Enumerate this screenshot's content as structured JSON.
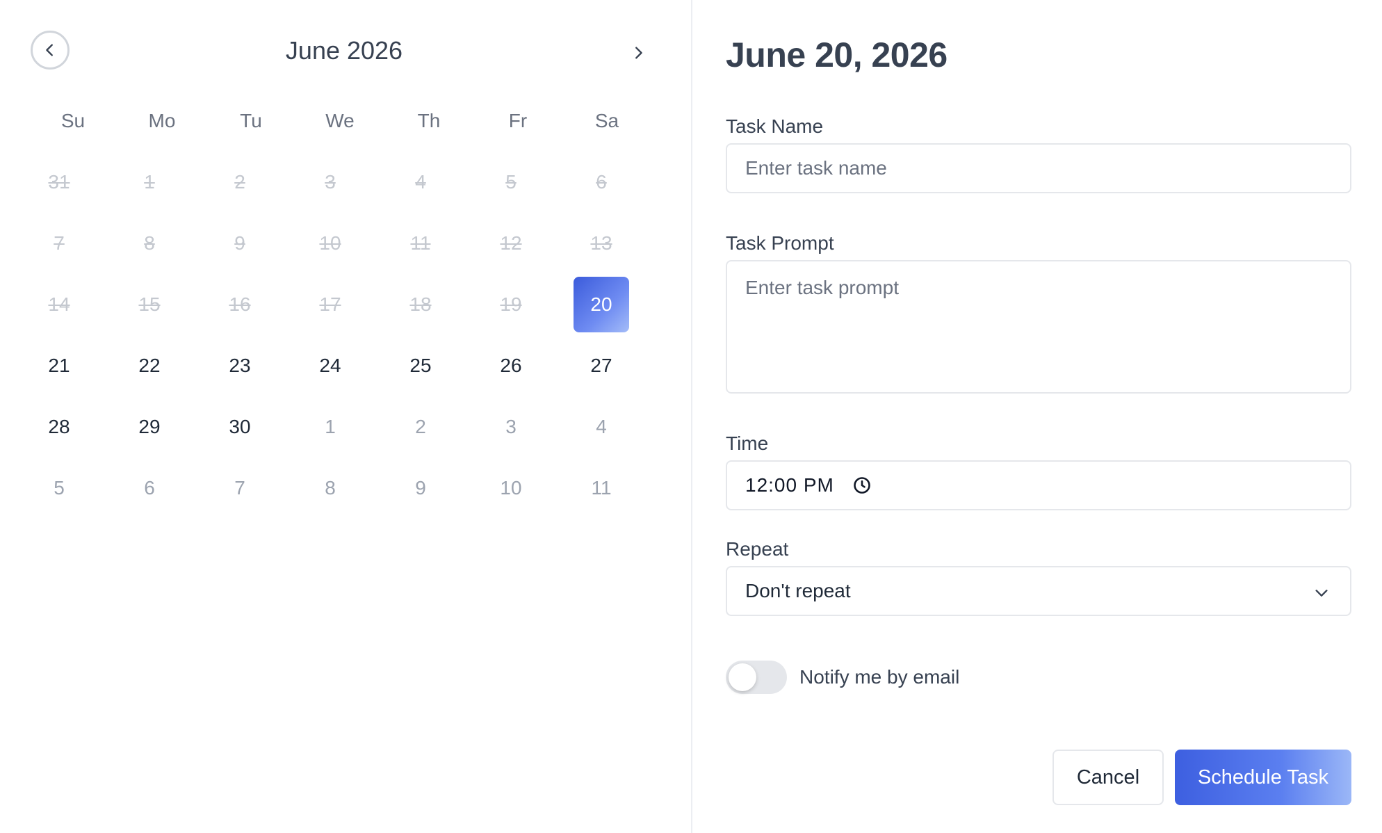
{
  "calendar": {
    "month_title": "June 2026",
    "weekdays": [
      "Su",
      "Mo",
      "Tu",
      "We",
      "Th",
      "Fr",
      "Sa"
    ],
    "weeks": [
      [
        {
          "label": "31",
          "state": "past"
        },
        {
          "label": "1",
          "state": "past"
        },
        {
          "label": "2",
          "state": "past"
        },
        {
          "label": "3",
          "state": "past"
        },
        {
          "label": "4",
          "state": "past"
        },
        {
          "label": "5",
          "state": "past"
        },
        {
          "label": "6",
          "state": "past"
        }
      ],
      [
        {
          "label": "7",
          "state": "past"
        },
        {
          "label": "8",
          "state": "past"
        },
        {
          "label": "9",
          "state": "past"
        },
        {
          "label": "10",
          "state": "past"
        },
        {
          "label": "11",
          "state": "past"
        },
        {
          "label": "12",
          "state": "past"
        },
        {
          "label": "13",
          "state": "past"
        }
      ],
      [
        {
          "label": "14",
          "state": "past"
        },
        {
          "label": "15",
          "state": "past"
        },
        {
          "label": "16",
          "state": "past"
        },
        {
          "label": "17",
          "state": "past"
        },
        {
          "label": "18",
          "state": "past"
        },
        {
          "label": "19",
          "state": "past"
        },
        {
          "label": "20",
          "state": "selected"
        }
      ],
      [
        {
          "label": "21",
          "state": "current"
        },
        {
          "label": "22",
          "state": "current"
        },
        {
          "label": "23",
          "state": "current"
        },
        {
          "label": "24",
          "state": "current"
        },
        {
          "label": "25",
          "state": "current"
        },
        {
          "label": "26",
          "state": "current"
        },
        {
          "label": "27",
          "state": "current"
        }
      ],
      [
        {
          "label": "28",
          "state": "current"
        },
        {
          "label": "29",
          "state": "current"
        },
        {
          "label": "30",
          "state": "current"
        },
        {
          "label": "1",
          "state": "other"
        },
        {
          "label": "2",
          "state": "other"
        },
        {
          "label": "3",
          "state": "other"
        },
        {
          "label": "4",
          "state": "other"
        }
      ],
      [
        {
          "label": "5",
          "state": "other"
        },
        {
          "label": "6",
          "state": "other"
        },
        {
          "label": "7",
          "state": "other"
        },
        {
          "label": "8",
          "state": "other"
        },
        {
          "label": "9",
          "state": "other"
        },
        {
          "label": "10",
          "state": "other"
        },
        {
          "label": "11",
          "state": "other"
        }
      ]
    ],
    "prev_icon": "chevron-left-icon",
    "next_icon": "chevron-right-icon"
  },
  "form": {
    "date_heading": "June 20, 2026",
    "task_name_label": "Task Name",
    "task_name_placeholder": "Enter task name",
    "task_prompt_label": "Task Prompt",
    "task_prompt_placeholder": "Enter task prompt",
    "time_label": "Time",
    "time_value": "12:00 PM",
    "time_icon": "clock-icon",
    "repeat_label": "Repeat",
    "repeat_value": "Don't repeat",
    "repeat_icon": "chevron-down-icon",
    "notify_label": "Notify me by email",
    "notify_enabled": false
  },
  "actions": {
    "cancel_label": "Cancel",
    "schedule_label": "Schedule Task"
  },
  "colors": {
    "accent": "#3b5bdb",
    "accent_light": "#9bb7f7",
    "text": "#374151",
    "muted": "#9ca3af",
    "border": "#e5e7eb"
  }
}
